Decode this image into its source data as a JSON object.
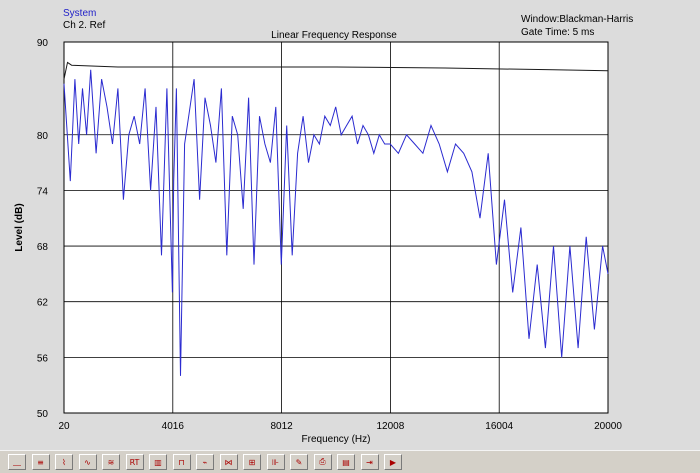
{
  "legend": {
    "series": "System",
    "reference": "Ch 2. Ref"
  },
  "info": {
    "window": "Window:Blackman-Harris",
    "gate": "Gate Time: 5 ms"
  },
  "chart_data": {
    "type": "line",
    "title": "Linear Frequency Response",
    "xlabel": "Frequency (Hz)",
    "ylabel": "Level (dB)",
    "xlim": [
      20,
      20000
    ],
    "ylim": [
      50,
      90
    ],
    "xticks": [
      "20",
      "4016",
      "8012",
      "12008",
      "16004",
      "20000"
    ],
    "yticks": [
      "90",
      "80",
      "74",
      "68",
      "62",
      "56",
      "50"
    ],
    "grid": true,
    "colors": {
      "system": "#2b2bd0",
      "reference": "#1a1a1a",
      "grid": "#000000",
      "plot_bg": "#ffffff"
    },
    "series": [
      {
        "name": "System",
        "x": [
          20,
          250,
          420,
          560,
          700,
          850,
          1000,
          1200,
          1400,
          1600,
          1800,
          2000,
          2200,
          2400,
          2600,
          2800,
          3000,
          3200,
          3400,
          3600,
          3800,
          4000,
          4050,
          4150,
          4300,
          4450,
          4600,
          4800,
          5000,
          5200,
          5400,
          5600,
          5800,
          6000,
          6200,
          6400,
          6600,
          6800,
          7000,
          7200,
          7400,
          7600,
          7800,
          8000,
          8200,
          8400,
          8600,
          8800,
          9000,
          9200,
          9400,
          9600,
          9800,
          10000,
          10200,
          10400,
          10600,
          10800,
          11000,
          11200,
          11400,
          11600,
          11800,
          12000,
          12300,
          12600,
          12900,
          13200,
          13500,
          13800,
          14100,
          14400,
          14700,
          15000,
          15300,
          15600,
          15900,
          16200,
          16500,
          16800,
          17100,
          17400,
          17700,
          18000,
          18300,
          18600,
          18900,
          19200,
          19500,
          19800,
          20000
        ],
        "values": [
          85.5,
          75,
          86,
          79,
          85,
          80,
          87,
          78,
          86,
          83,
          79,
          85,
          73,
          80,
          82,
          79,
          85,
          74,
          83,
          67,
          85,
          63,
          75,
          85,
          54,
          79,
          82,
          86,
          73,
          84,
          81,
          77,
          85,
          67,
          82,
          80,
          72,
          84,
          66,
          82,
          79,
          77,
          83,
          66,
          81,
          67,
          78,
          82,
          77,
          80,
          79,
          82,
          81,
          83,
          80,
          81,
          82,
          79,
          81,
          80,
          78,
          80,
          79,
          79,
          78,
          80,
          79,
          78,
          81,
          79,
          76,
          79,
          78,
          76,
          71,
          78,
          66,
          73,
          63,
          70,
          58,
          66,
          57,
          68,
          56,
          68,
          57,
          69,
          59,
          68,
          65
        ]
      },
      {
        "name": "Ch 2. Ref",
        "x": [
          20,
          150,
          300,
          2000,
          6000,
          10000,
          14000,
          18000,
          20000
        ],
        "values": [
          86,
          87.8,
          87.5,
          87.3,
          87.3,
          87.3,
          87.2,
          87.0,
          86.9
        ]
      }
    ]
  },
  "toolbar": [
    {
      "icon": "baseline-icon",
      "glyph": "⎽"
    },
    {
      "icon": "scale-icon",
      "glyph": "≡"
    },
    {
      "icon": "cursor-peak-icon",
      "glyph": "⌇"
    },
    {
      "icon": "waveform-icon",
      "glyph": "∿"
    },
    {
      "icon": "overlay-icon",
      "glyph": "≋"
    },
    {
      "icon": "rt-icon",
      "glyph": "RT"
    },
    {
      "icon": "bar-graph-icon",
      "glyph": "▥"
    },
    {
      "icon": "envelope-icon",
      "glyph": "⊓"
    },
    {
      "icon": "spectrum-icon",
      "glyph": "⌁"
    },
    {
      "icon": "compare-icon",
      "glyph": "⋈"
    },
    {
      "icon": "gate-icon",
      "glyph": "⊞"
    },
    {
      "icon": "bars-icon",
      "glyph": "⊪"
    },
    {
      "icon": "marker-icon",
      "glyph": "✎"
    },
    {
      "icon": "print-icon",
      "glyph": "⎙"
    },
    {
      "icon": "export-icon",
      "glyph": "▤"
    },
    {
      "icon": "settings-icon",
      "glyph": "⇥"
    },
    {
      "icon": "play-icon",
      "glyph": "▶"
    }
  ]
}
